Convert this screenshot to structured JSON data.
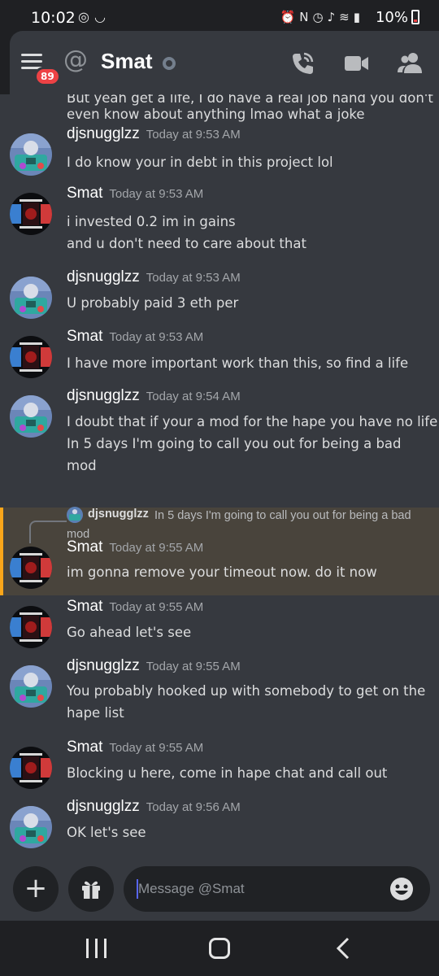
{
  "status_bar": {
    "time": "10:02",
    "battery": "10%",
    "left_icons": [
      "instagram-icon",
      "smile-icon"
    ],
    "right_icons": [
      "alarm-icon",
      "nfc-icon",
      "clock-icon",
      "mute-icon",
      "wifi-icon",
      "signal-icon",
      "battery-icon"
    ]
  },
  "header": {
    "menu_badge": "89",
    "at_symbol": "@",
    "channel": "Smat",
    "actions": [
      "call-icon",
      "video-icon",
      "members-icon"
    ]
  },
  "top_fragment": {
    "cut_line": "But yeah get a life, I do have a real job hand you don't",
    "line": "even know about anything lmao what a joke"
  },
  "messages": [
    {
      "author": "djsnugglzz",
      "time": "Today at 9:53 AM",
      "lines": [
        "I do know your in debt in this project lol"
      ],
      "avatar": "robot"
    },
    {
      "author": "Smat",
      "time": "Today at 9:53 AM",
      "lines": [
        "i invested 0.2 im in gains",
        "and u don't need to care about that"
      ],
      "avatar": "tunnel"
    },
    {
      "author": "djsnugglzz",
      "time": "Today at 9:53 AM",
      "lines": [
        "U probably paid 3 eth per"
      ],
      "avatar": "robot"
    },
    {
      "author": "Smat",
      "time": "Today at 9:53 AM",
      "lines": [
        "I have more important work than this, so find a life"
      ],
      "avatar": "tunnel"
    },
    {
      "author": "djsnugglzz",
      "time": "Today at 9:54 AM",
      "lines": [
        "I doubt that if your a mod for the hape you have no life",
        "In 5 days I'm going to call you out for being a bad",
        "mod"
      ],
      "avatar": "robot"
    },
    {
      "author": "Smat",
      "time": "Today at 9:55 AM",
      "lines": [
        "im gonna remove your timeout now. do it now"
      ],
      "avatar": "tunnel"
    },
    {
      "author": "Smat",
      "time": "Today at 9:55 AM",
      "lines": [
        "Go ahead let's see"
      ],
      "avatar": "tunnel"
    },
    {
      "author": "djsnugglzz",
      "time": "Today at 9:55 AM",
      "lines": [
        "You probably hooked up with somebody to get on the",
        "hape list"
      ],
      "avatar": "robot"
    },
    {
      "author": "Smat",
      "time": "Today at 9:55 AM",
      "lines": [
        "Blocking u here, come in hape chat and call out"
      ],
      "avatar": "tunnel"
    },
    {
      "author": "djsnugglzz",
      "time": "Today at 9:56 AM",
      "lines": [
        "OK let's see"
      ],
      "avatar": "robot"
    }
  ],
  "reply": {
    "author": "djsnugglzz",
    "text": "In 5 days I'm going to call you out for being a bad mod"
  },
  "composer": {
    "placeholder": "Message @Smat"
  },
  "colors": {
    "background": "#36393f",
    "reply_highlight": "#49443c",
    "highlight_bar": "#faa61a",
    "badge": "#ed4245",
    "caret": "#5865f2"
  }
}
